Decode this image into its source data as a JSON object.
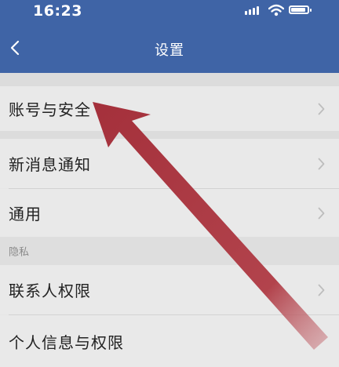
{
  "status": {
    "time": "16:23"
  },
  "header": {
    "title": "设置"
  },
  "items": [
    {
      "label": "账号与安全"
    },
    {
      "label": "新消息通知"
    },
    {
      "label": "通用"
    },
    {
      "label": "联系人权限"
    },
    {
      "label": "个人信息与权限"
    }
  ],
  "section": {
    "privacy_label": "隐私"
  },
  "colors": {
    "header": "#3f64a6",
    "arrow": "#a83640"
  }
}
